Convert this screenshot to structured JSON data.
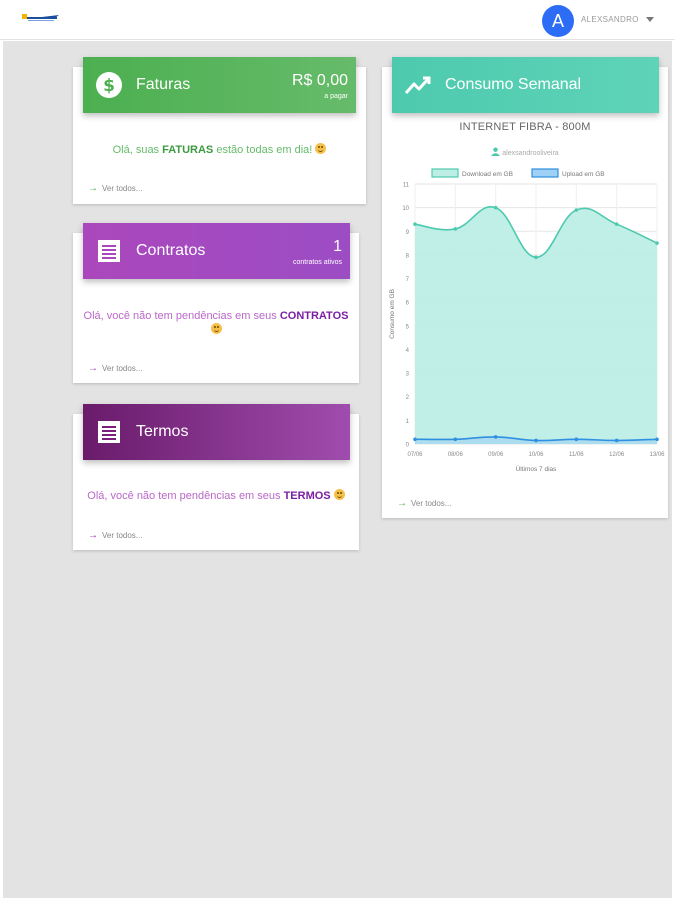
{
  "topbar": {
    "user_initial": "A",
    "username": "ALEXSANDRO"
  },
  "faturas": {
    "title": "Faturas",
    "value": "R$ 0,00",
    "value_sub": "a pagar",
    "msg_pre": "Olá, suas ",
    "msg_bold": "FATURAS",
    "msg_post": " estão todas em dia!",
    "link": "Ver todos...",
    "color": "#4caf50"
  },
  "contratos": {
    "title": "Contratos",
    "value": "1",
    "value_sub": "contratos ativos",
    "msg_pre": "Olá, você não tem pendências em seus ",
    "msg_bold": "CONTRATOS",
    "link": "Ver todos...",
    "color": "#ab47bc"
  },
  "termos": {
    "title": "Termos",
    "msg_pre": "Olá, você não tem pendências em seus ",
    "msg_bold": "TERMOS",
    "link": "Ver todos...",
    "color": "#7b1fa2"
  },
  "consumo": {
    "title": "Consumo Semanal",
    "link": "Ver todos...",
    "color": "#4dcaae"
  },
  "chart_data": {
    "type": "area",
    "title": "INTERNET FIBRA - 800M",
    "subtitle": "alexsandrooliveira",
    "xlabel": "Últimos 7 dias",
    "ylabel": "Consumo em GB",
    "categories": [
      "07/06",
      "08/06",
      "09/06",
      "10/06",
      "11/06",
      "12/06",
      "13/06"
    ],
    "ylim": [
      0,
      11
    ],
    "yticks": [
      0,
      1,
      2,
      3,
      4,
      5,
      6,
      7,
      8,
      9,
      10,
      11
    ],
    "grid": true,
    "legend_position": "top",
    "series": [
      {
        "name": "Download em GB",
        "values": [
          9.3,
          9.1,
          10.0,
          7.9,
          9.9,
          9.3,
          8.5
        ],
        "color": "#4dcaae",
        "fill": "#bdeee6"
      },
      {
        "name": "Upload em GB",
        "values": [
          0.2,
          0.2,
          0.3,
          0.15,
          0.2,
          0.15,
          0.2
        ],
        "color": "#2f8fe0",
        "fill": "#9fd0f5"
      }
    ]
  }
}
